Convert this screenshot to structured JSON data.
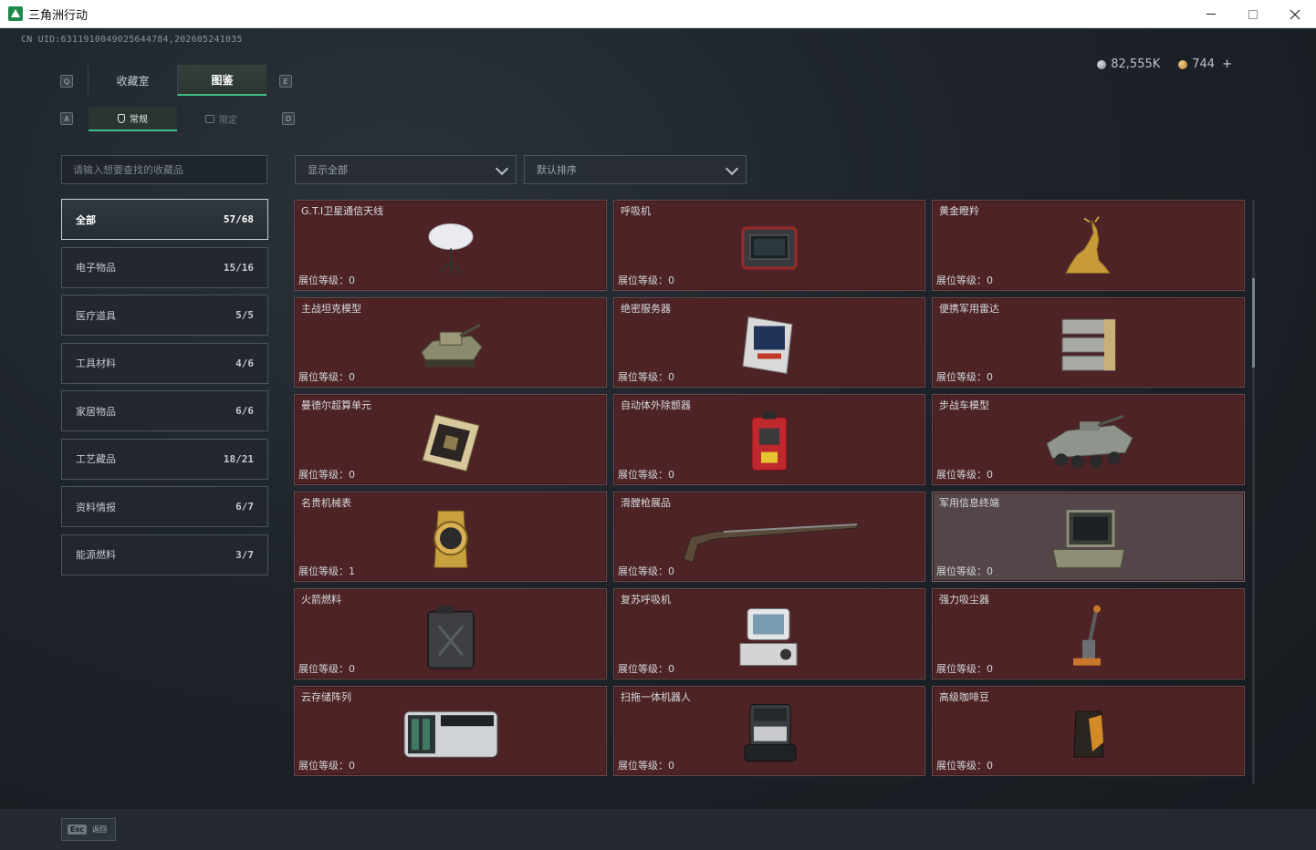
{
  "window": {
    "title": "三角洲行动"
  },
  "uid": "CN UID:6311910049025644784,202605241035",
  "currency": {
    "silver": "82,555K",
    "gold": "744",
    "gold_plus": "+"
  },
  "keys": {
    "q": "Q",
    "e": "E",
    "a": "A",
    "d": "D"
  },
  "tabs": [
    {
      "label": "收藏室"
    },
    {
      "label": "图鉴"
    }
  ],
  "subtabs": [
    {
      "label": "常规"
    },
    {
      "label": "限定"
    }
  ],
  "search": {
    "placeholder": "请输入想要查找的收藏品"
  },
  "filter": {
    "value": "显示全部"
  },
  "sort": {
    "value": "默认排序"
  },
  "categories": [
    {
      "label": "全部",
      "count": "57/68"
    },
    {
      "label": "电子物品",
      "count": "15/16"
    },
    {
      "label": "医疗道具",
      "count": "5/5"
    },
    {
      "label": "工具材料",
      "count": "4/6"
    },
    {
      "label": "家居物品",
      "count": "6/6"
    },
    {
      "label": "工艺藏品",
      "count": "18/21"
    },
    {
      "label": "资料情报",
      "count": "6/7"
    },
    {
      "label": "能源燃料",
      "count": "3/7"
    }
  ],
  "items": [
    {
      "name": "G.T.I卫星通信天线",
      "level": "展位等级：0",
      "icon": "satellite-dish-icon"
    },
    {
      "name": "呼吸机",
      "level": "展位等级：0",
      "icon": "ventilator-icon"
    },
    {
      "name": "黄金瞪羚",
      "level": "展位等级：0",
      "icon": "golden-gazelle-icon"
    },
    {
      "name": "主战坦克模型",
      "level": "展位等级：0",
      "icon": "tank-model-icon"
    },
    {
      "name": "绝密服务器",
      "level": "展位等级：0",
      "icon": "server-icon"
    },
    {
      "name": "便携军用雷达",
      "level": "展位等级：0",
      "icon": "radar-icon"
    },
    {
      "name": "曼德尔超算单元",
      "level": "展位等级：0",
      "icon": "supercomputer-unit-icon"
    },
    {
      "name": "自动体外除颤器",
      "level": "展位等级：0",
      "icon": "defibrillator-icon"
    },
    {
      "name": "步战车模型",
      "level": "展位等级：0",
      "icon": "ifv-model-icon"
    },
    {
      "name": "名贵机械表",
      "level": "展位等级：1",
      "icon": "watch-icon"
    },
    {
      "name": "滑膛枪展品",
      "level": "展位等级：0",
      "icon": "musket-icon"
    },
    {
      "name": "军用信息终端",
      "level": "展位等级：0",
      "icon": "military-terminal-icon"
    },
    {
      "name": "火箭燃料",
      "level": "展位等级：0",
      "icon": "fuel-can-icon"
    },
    {
      "name": "复苏呼吸机",
      "level": "展位等级：0",
      "icon": "resuscitator-icon"
    },
    {
      "name": "强力吸尘器",
      "level": "展位等级：0",
      "icon": "vacuum-icon"
    },
    {
      "name": "云存储阵列",
      "level": "展位等级：0",
      "icon": "storage-array-icon"
    },
    {
      "name": "扫拖一体机器人",
      "level": "展位等级：0",
      "icon": "robot-vacuum-icon"
    },
    {
      "name": "高级咖啡豆",
      "level": "展位等级：0",
      "icon": "coffee-beans-icon"
    }
  ],
  "footer": {
    "esc_key": "Esc",
    "esc_label": "返回"
  },
  "colors": {
    "accent": "#3fbf86",
    "card_bg": "#4d2326",
    "card_bg_alt": "#544548"
  }
}
